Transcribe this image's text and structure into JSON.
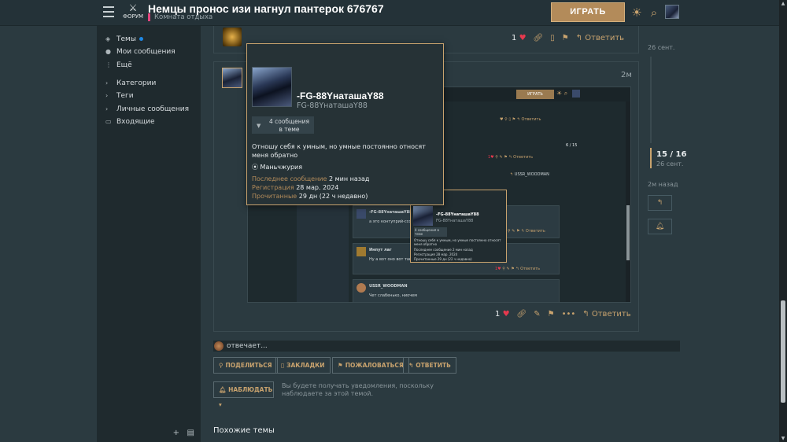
{
  "header": {
    "title": "Немцы пронос изи нагнул пантерок 676767",
    "subtitle": "Комната отдыха",
    "play_label": "ИГРАТЬ",
    "logo_text": "ФОРУМ"
  },
  "sidebar": {
    "items": [
      {
        "label": "Темы"
      },
      {
        "label": "Мои сообщения"
      },
      {
        "label": "Ещё"
      },
      {
        "label": "Категории"
      },
      {
        "label": "Теги"
      },
      {
        "label": "Личные сообщения"
      },
      {
        "label": "Входящие"
      }
    ]
  },
  "post1": {
    "likes": "1",
    "reply_label": "Ответить"
  },
  "post2": {
    "time": "2м",
    "likes": "1",
    "reply_label": "Ответить"
  },
  "tooltip": {
    "name": "-FG-88YнaтaшaY88",
    "username": "FG-88YнaтaшaY88",
    "filter_label": "4 сообщения в теме",
    "about": "Отношу себя к умным, но умные постоянно относят меня обратно",
    "location": "Маньчжурия",
    "last_post_label": "Последнее сообщение",
    "last_post_value": "2 мин назад",
    "registered_label": "Регистрация",
    "registered_value": "28 мар. 2024",
    "read_label": "Прочитанные",
    "read_value": "29 дн (22 ч недавно)"
  },
  "embed": {
    "play_label": "ИГРАТЬ",
    "post_user_1": "-FG-88YнaтaшaY88",
    "post_text_1": "а это контуприй-ссссорр",
    "post_user_2": "Инпут лаг",
    "post_text_2": "Ну а вот оно вот так вот",
    "post_user_3": "USSR_WOODMAN",
    "post_text_3": "Чет слабенько, ниочем",
    "author_tag": "USSR_WOODMAN",
    "counter": "6 / 15",
    "reply": "Ответить",
    "tip_name": "-FG-88YнaтaшaY88",
    "tip_user": "FG-88YнaтaшaY88",
    "tip_filter": "4 сообщения в теме",
    "tip_about": "Отношу себя к умным, но умные постоянно относят меня обратно",
    "tip_last": "Последнее сообщение 2 мин назад",
    "tip_reg": "Регистрация 28 мар. 2024",
    "tip_read": "Прочитанные 29 дн (22 ч недавно)"
  },
  "rail": {
    "top_date": "26 сент.",
    "counter": "15 / 16",
    "counter_date": "26 сент.",
    "last_time": "2м назад"
  },
  "replying": "отвечает...",
  "buttons": {
    "share": "ПОДЕЛИТЬСЯ",
    "bookmark": "ЗАКЛАДКИ",
    "flag": "ПОЖАЛОВАТЬСЯ",
    "reply": "ОТВЕТИТЬ",
    "watch": "НАБЛЮДАТЬ"
  },
  "watch_note": "Вы будете получать уведомления, поскольку наблюдаете за этой темой.",
  "similar_title": "Похожие темы",
  "colors": {
    "accent": "#c9a36e",
    "heart": "#e5394e",
    "tag": "#e2457d",
    "background": "#2b3a40"
  }
}
